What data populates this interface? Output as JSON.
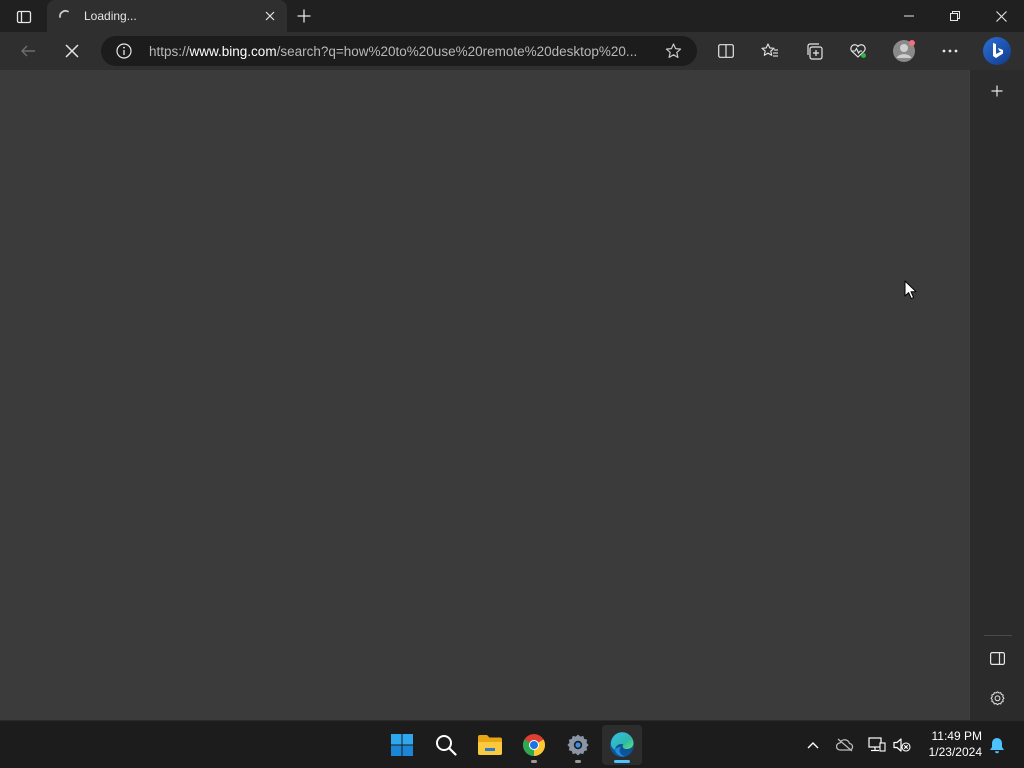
{
  "browser": {
    "tab": {
      "title": "Loading...",
      "status": "loading"
    },
    "address_bar": {
      "scheme": "https://",
      "host": "www.bing.com",
      "path": "/search?q=how%20to%20use%20remote%20desktop%20..."
    },
    "sidebar": {
      "items": [
        "add-icon",
        "hide-sidebar-icon",
        "settings-icon"
      ]
    },
    "colors": {
      "content_bg": "#3b3b3b",
      "titlebar_bg": "#202020",
      "toolbar_bg": "#2f2f2f",
      "accent": "#4cc2ff"
    }
  },
  "taskbar": {
    "apps": [
      "windows-start",
      "search",
      "file-explorer",
      "chrome",
      "settings",
      "edge"
    ],
    "active_app": "edge",
    "clock": {
      "time": "11:49 PM",
      "date": "1/23/2024"
    }
  }
}
